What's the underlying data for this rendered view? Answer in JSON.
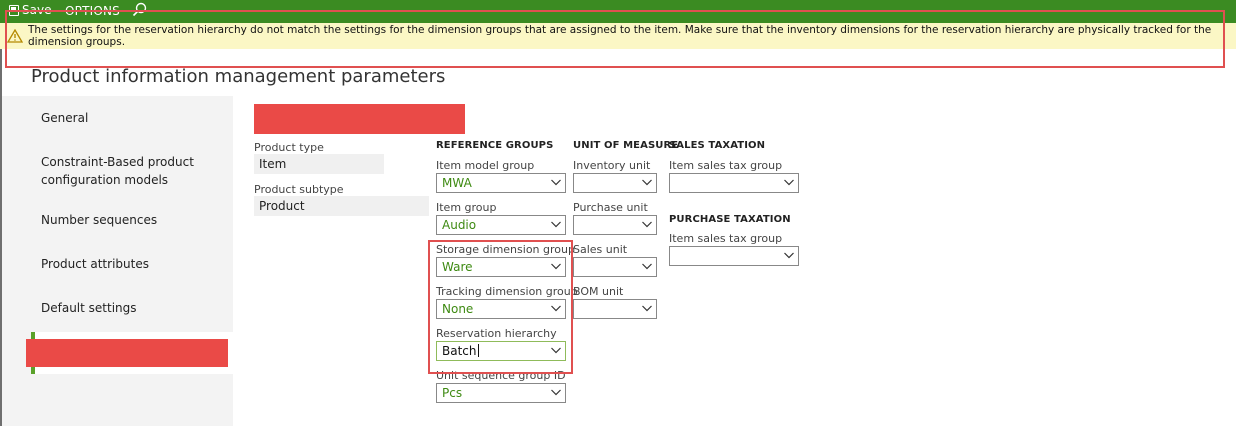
{
  "toolbar": {
    "save_label": "Save",
    "options_label": "OPTIONS",
    "search_icon": "search-icon",
    "save_icon": "save-icon"
  },
  "warning": {
    "icon": "warning-icon",
    "text": "The settings for the reservation hierarchy do not match the settings for the dimension groups that are assigned to the item. Make sure that the inventory dimensions for the reservation hierarchy are physically tracked for the dimension groups."
  },
  "page_title": "Product information management parameters",
  "nav": {
    "items": [
      {
        "label": "General"
      },
      {
        "label": "Constraint-Based product configuration models"
      },
      {
        "label": "Number sequences"
      },
      {
        "label": "Product attributes"
      },
      {
        "label": "Default settings"
      }
    ]
  },
  "product": {
    "type_label": "Product type",
    "type_value": "Item",
    "subtype_label": "Product subtype",
    "subtype_value": "Product"
  },
  "reference_groups": {
    "header": "REFERENCE GROUPS",
    "item_model_group": {
      "label": "Item model group",
      "value": "MWA"
    },
    "item_group": {
      "label": "Item group",
      "value": "Audio"
    },
    "storage_dimension_group": {
      "label": "Storage dimension group",
      "value": "Ware"
    },
    "tracking_dimension_group": {
      "label": "Tracking dimension group",
      "value": "None"
    },
    "reservation_hierarchy": {
      "label": "Reservation hierarchy",
      "value": "Batch"
    },
    "unit_sequence_group": {
      "label": "Unit sequence group ID",
      "value": "Pcs"
    }
  },
  "unit_of_measure": {
    "header": "UNIT OF MEASURE",
    "inventory_unit": {
      "label": "Inventory unit",
      "value": ""
    },
    "purchase_unit": {
      "label": "Purchase unit",
      "value": ""
    },
    "sales_unit": {
      "label": "Sales unit",
      "value": ""
    },
    "bom_unit": {
      "label": "BOM unit",
      "value": ""
    }
  },
  "sales_taxation": {
    "header": "SALES TAXATION",
    "item_sales_tax_group": {
      "label": "Item sales tax group",
      "value": ""
    }
  },
  "purchase_taxation": {
    "header": "PURCHASE TAXATION",
    "item_sales_tax_group": {
      "label": "Item sales tax group",
      "value": ""
    }
  },
  "colors": {
    "command_bar": "#3b8b22",
    "warning_bg": "#fbf7c5",
    "accent_green": "#5aa12a",
    "highlight_outline": "#e05050",
    "redaction": "#ea4a47"
  }
}
